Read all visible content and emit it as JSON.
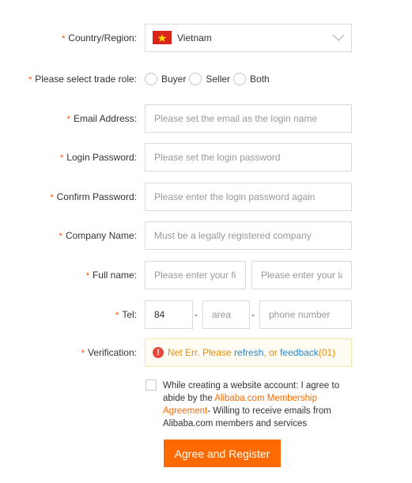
{
  "form": {
    "required_mark": "*",
    "country": {
      "label": "Country/Region:",
      "value": "Vietnam",
      "flag": "vietnam-flag-icon"
    },
    "trade_role": {
      "label": "Please select trade role:",
      "options": [
        "Buyer",
        "Seller",
        "Both"
      ]
    },
    "email": {
      "label": "Email Address:",
      "placeholder": "Please set the email as the login name"
    },
    "password": {
      "label": "Login Password:",
      "placeholder": "Please set the login password"
    },
    "confirm_password": {
      "label": "Confirm Password:",
      "placeholder": "Please enter the login password again"
    },
    "company": {
      "label": "Company Name:",
      "placeholder": "Must be a legally registered company"
    },
    "full_name": {
      "label": "Full name:",
      "first_placeholder": "Please enter your first name",
      "last_placeholder": "Please enter your last name"
    },
    "tel": {
      "label": "Tel:",
      "country_code": "84",
      "area_placeholder": "area",
      "number_placeholder": "phone number",
      "separator": "-"
    },
    "verification": {
      "label": "Verification:",
      "message_prefix": "Net Err. Please ",
      "refresh_link": "refresh",
      "middle": ", or ",
      "feedback_link": "feedback",
      "code": " (01)"
    },
    "agreement": {
      "text_before": "While creating a website account: I agree to abide by the ",
      "link": "Alibaba.com Membership Agreement",
      "text_after": "- Willing to receive emails from Alibaba.com members and services"
    },
    "submit_label": "Agree and Register"
  },
  "colors": {
    "accent": "#ff6a00",
    "required": "#ff4a00",
    "link_blue": "#1e88d8",
    "error_red": "#e7483c"
  }
}
